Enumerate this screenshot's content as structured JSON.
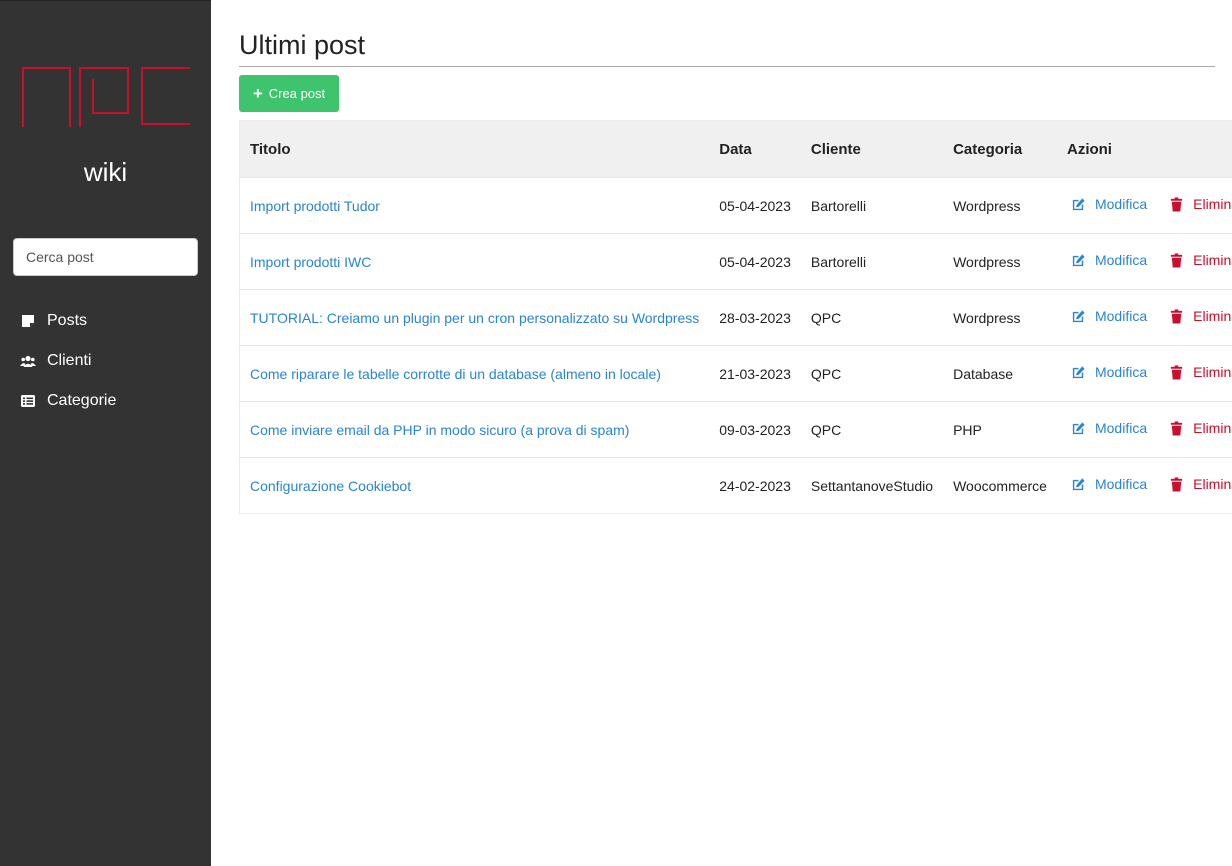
{
  "sidebar": {
    "wiki_label": "wiki",
    "search_placeholder": "Cerca post",
    "nav": [
      {
        "label": "Posts",
        "icon": "sticky-note-icon"
      },
      {
        "label": "Clienti",
        "icon": "users-icon"
      },
      {
        "label": "Categorie",
        "icon": "list-icon"
      }
    ]
  },
  "main": {
    "title": "Ultimi post",
    "create_label": "Crea post",
    "columns": {
      "title": "Titolo",
      "date": "Data",
      "client": "Cliente",
      "category": "Categoria",
      "actions": "Azioni"
    },
    "edit_label": "Modifica",
    "delete_label": "Elimina",
    "rows": [
      {
        "title": "Import prodotti Tudor",
        "date": "05-04-2023",
        "client": "Bartorelli",
        "category": "Wordpress"
      },
      {
        "title": "Import prodotti IWC",
        "date": "05-04-2023",
        "client": "Bartorelli",
        "category": "Wordpress"
      },
      {
        "title": "TUTORIAL: Creiamo un plugin per un cron personalizzato su Wordpress",
        "date": "28-03-2023",
        "client": "QPC",
        "category": "Wordpress"
      },
      {
        "title": "Come riparare le tabelle corrotte di un database (almeno in locale)",
        "date": "21-03-2023",
        "client": "QPC",
        "category": "Database"
      },
      {
        "title": "Come inviare email da PHP in modo sicuro (a prova di spam)",
        "date": "09-03-2023",
        "client": "QPC",
        "category": "PHP"
      },
      {
        "title": "Configurazione Cookiebot",
        "date": "24-02-2023",
        "client": "SettantanoveStudio",
        "category": "Woocommerce"
      }
    ]
  },
  "colors": {
    "sidebar_bg": "#333333",
    "logo_red": "#c8102e",
    "link_blue": "#2a84d3",
    "create_green": "#3ec46d",
    "delete_red": "#c8102e"
  }
}
